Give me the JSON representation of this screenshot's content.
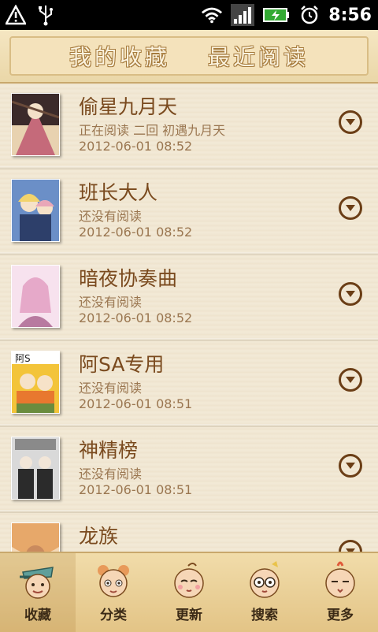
{
  "status_bar": {
    "time": "8:56",
    "icons": [
      "warning-icon",
      "usb-icon",
      "wifi-icon",
      "signal-icon",
      "battery-icon",
      "alarm-icon"
    ]
  },
  "header": {
    "tabs": [
      {
        "label": "我的收藏",
        "active": true
      },
      {
        "label": "最近阅读",
        "active": false
      }
    ]
  },
  "comics": [
    {
      "title": "偷星九月天",
      "status": "正在阅读  二回 初遇九月天",
      "date": "2012-06-01 08:52",
      "cover_colors": [
        "#3b2a2a",
        "#c56a7a",
        "#e8d2b0"
      ]
    },
    {
      "title": "班长大人",
      "status": "还没有阅读",
      "date": "2012-06-01 08:52",
      "cover_colors": [
        "#6b8fc7",
        "#f2d36b",
        "#e9a7b8"
      ]
    },
    {
      "title": "暗夜协奏曲",
      "status": "还没有阅读",
      "date": "2012-06-01 08:52",
      "cover_colors": [
        "#e6a9c9",
        "#f7e2ee",
        "#b87aa0"
      ]
    },
    {
      "title": "阿SA专用",
      "status": "还没有阅读",
      "date": "2012-06-01 08:51",
      "cover_colors": [
        "#f3c43a",
        "#e8782f",
        "#6a8c3e"
      ]
    },
    {
      "title": "神精榜",
      "status": "还没有阅读",
      "date": "2012-06-01 08:51",
      "cover_colors": [
        "#2b2b2b",
        "#d9d9d9",
        "#8a8a8a"
      ]
    },
    {
      "title": "龙族",
      "status": "",
      "date": "",
      "cover_colors": [
        "#e7a86a",
        "#f4d9b8",
        "#c98a5e"
      ]
    }
  ],
  "bottom_tabs": [
    {
      "label": "收藏",
      "icon": "favorites-mascot-icon",
      "active": true
    },
    {
      "label": "分类",
      "icon": "category-mascot-icon",
      "active": false
    },
    {
      "label": "更新",
      "icon": "update-mascot-icon",
      "active": false
    },
    {
      "label": "搜索",
      "icon": "search-mascot-icon",
      "active": false
    },
    {
      "label": "更多",
      "icon": "more-mascot-icon",
      "active": false
    }
  ],
  "colors": {
    "title": "#7a4a1e",
    "meta": "#9a7650",
    "accent": "#6b3e16"
  }
}
